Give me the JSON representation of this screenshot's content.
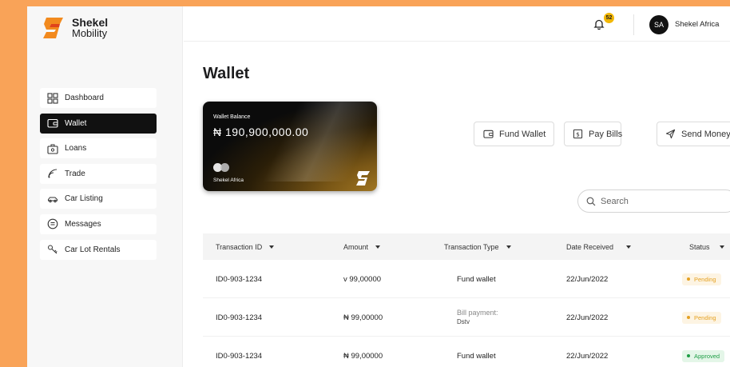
{
  "brand": {
    "name_line1": "Shekel",
    "name_line2": "Mobility",
    "colors": {
      "orange": "#f9a358",
      "dark": "#111111",
      "gold": "#b8892a"
    }
  },
  "sidebar": {
    "items": [
      {
        "label": "Dashboard",
        "icon": "grid-icon",
        "active": false
      },
      {
        "label": "Wallet",
        "icon": "wallet-icon",
        "active": true
      },
      {
        "label": "Loans",
        "icon": "loans-icon",
        "active": false
      },
      {
        "label": "Trade",
        "icon": "trade-icon",
        "active": false
      },
      {
        "label": "Car Listing",
        "icon": "car-icon",
        "active": false
      },
      {
        "label": "Messages",
        "icon": "message-icon",
        "active": false
      },
      {
        "label": "Car Lot Rentals",
        "icon": "car-keys-icon",
        "active": false
      }
    ]
  },
  "header": {
    "notification_count": "52",
    "avatar_initials": "SA",
    "user_name": "Shekel Africa"
  },
  "main": {
    "title": "Wallet",
    "card": {
      "label": "Wallet Balance",
      "amount": "₦ 190,900,000.00",
      "holder": "Shekel Africa"
    },
    "actions": {
      "fund_wallet": "Fund Wallet",
      "pay_bills": "Pay Bills",
      "send_money": "Send Money"
    },
    "search": {
      "placeholder": "Search"
    },
    "table": {
      "headers": {
        "id": "Transaction ID",
        "amount": "Amount",
        "type": "Transaction Type",
        "date": "Date Received",
        "status": "Status"
      },
      "rows": [
        {
          "id": "ID0-903-1234",
          "amount": "v 99,00000",
          "type": "Fund wallet",
          "type_sub": "",
          "date": "22/Jun/2022",
          "status": "Pending",
          "status_kind": "pending"
        },
        {
          "id": "ID0-903-1234",
          "amount": "₦ 99,00000",
          "type": "Bill payment:",
          "type_sub": "Dstv",
          "date": "22/Jun/2022",
          "status": "Pending",
          "status_kind": "pending"
        },
        {
          "id": "ID0-903-1234",
          "amount": "₦ 99,00000",
          "type": "Fund wallet",
          "type_sub": "",
          "date": "22/Jun/2022",
          "status": "Approved",
          "status_kind": "approved"
        }
      ]
    }
  }
}
